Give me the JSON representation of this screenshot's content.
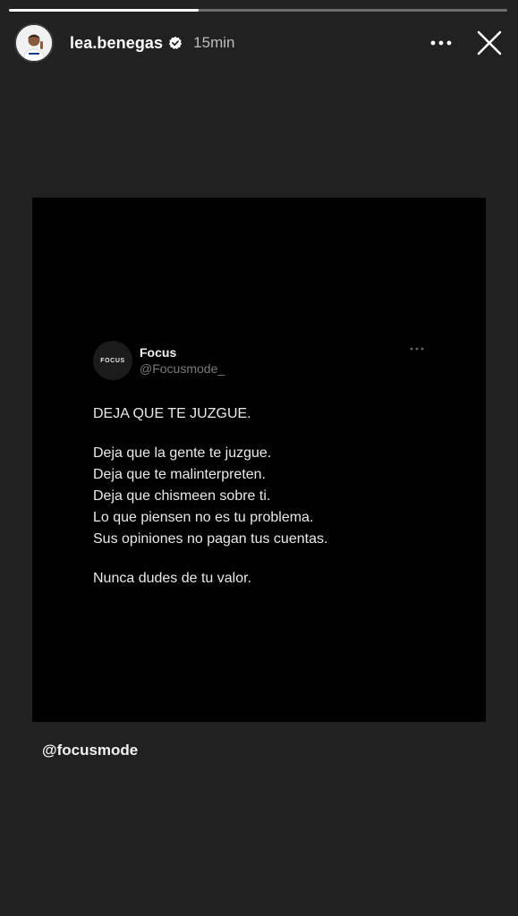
{
  "story": {
    "progress_fraction": 0.38,
    "progress_color": "#ffffff"
  },
  "header": {
    "username": "lea.benegas",
    "verified_icon": "verified-badge-icon",
    "time": "15min",
    "more_icon": "more-horizontal-icon",
    "close_icon": "close-icon"
  },
  "post": {
    "logo_text": "FOCUS",
    "author_name": "Focus",
    "author_handle": "@Focusmode_",
    "title": "DEJA QUE TE JUZGUE.",
    "lines": [
      "Deja que la gente te juzgue.",
      "Deja que te malinterpreten.",
      "Deja que chismeen sobre ti.",
      "Lo que piensen no es tu problema.",
      "Sus opiniones no pagan tus cuentas."
    ],
    "closing": "Nunca dudes de tu valor."
  },
  "mention": "@focusmode"
}
